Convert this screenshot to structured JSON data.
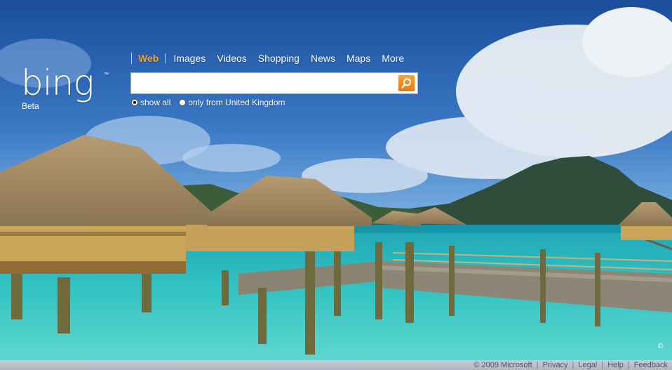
{
  "brand": {
    "name": "bing",
    "tagline": "Beta",
    "tm": "™"
  },
  "nav": {
    "items": [
      "Web",
      "Images",
      "Videos",
      "Shopping",
      "News",
      "Maps",
      "More"
    ],
    "active": "Web"
  },
  "search": {
    "value": "",
    "placeholder": ""
  },
  "scope": {
    "show_all": "show all",
    "only_uk": "only from United Kingdom",
    "selected": "show all"
  },
  "footer": {
    "copyright": "© 2009 Microsoft",
    "privacy": "Privacy",
    "legal": "Legal",
    "help": "Help",
    "feedback": "Feedback",
    "sep": "|"
  },
  "image_credit_icon": "©",
  "colors": {
    "accent": "#f5a122",
    "search_button": "#f08a1a"
  }
}
